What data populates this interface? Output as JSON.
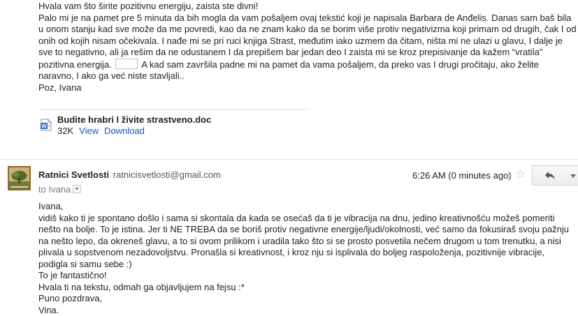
{
  "message1": {
    "lines": [
      "Hvala vam što širite pozitivnu energiju, zaista ste divni!",
      "Palo mi je na pamet pre 5 minuta da bih mogla da vam pošaljem ovaj tekstić koji je napisala Barbara de Anđelis. Danas sam baš bila u onom stanju kad sve može da me povredi, kao da ne znam kako da se borim više protiv negativizma koji primam od drugih, čak I od onih od kojih nisam očekivala. I nađe mi se pri ruci knjiga Strast, međutim iako uzmem da čitam, ništa mi ne ulazi u glavu, I dalje je sve to negativno, ali ja rešim da ne odustanem I da prepišem bar jedan deo I zaista mi se kroz prepisivanje da kažem “vratila” pozitivna energija."
    ],
    "line2_continued": "A kad sam završila padne mi na pamet da vama pošaljem, da preko vas I drugi pročitaju, ako želite naravno, I ako ga već niste stavljali..",
    "signoff": "Poz, Ivana"
  },
  "attachment": {
    "filename": "Budite hrabri I živite strastveno.doc",
    "size": "32K",
    "view_label": "View",
    "download_label": "Download",
    "icon": "word-document-icon"
  },
  "message2": {
    "sender_name": "Ratnici Svetlosti",
    "sender_email": "ratnicisvetlosti@gmail.com",
    "to": "to Ivana",
    "time": "6:26 AM (0 minutes ago)",
    "star_icon": "star-icon",
    "reply_icon": "reply-arrow-icon",
    "body": [
      "Ivana,",
      "vidiš kako ti je spontano došlo i sama si skontala da kada se osećaš da ti je vibracija na dnu, jedino kreativnošću možeš pomeriti nešto na bolje. To je istina. Jer ti NE TREBA da se boriš protiv negativne energije/ljudi/okolnosti, već samo da fokusiraš svoju pažnju na nešto lepo, da okreneš glavu, a to si ovom prilikom i uradila tako što si se prosto posvetila nečem drugom u tom trenutku, a nisi plivala u sopstvenom nezadovoljstvu. Pronašla si kreativnost, i kroz nju si isplivala do boljeg raspoloženja, pozitivnije vibracije, podigla si samu sebe :)",
      "To je fantastično!",
      "Hvala ti na tekstu, odmah ga objavljujem na fejsu :*",
      "Puno pozdrava,",
      "Vina."
    ]
  },
  "colors": {
    "link": "#1155cc",
    "text": "#222222",
    "muted": "#777777"
  }
}
